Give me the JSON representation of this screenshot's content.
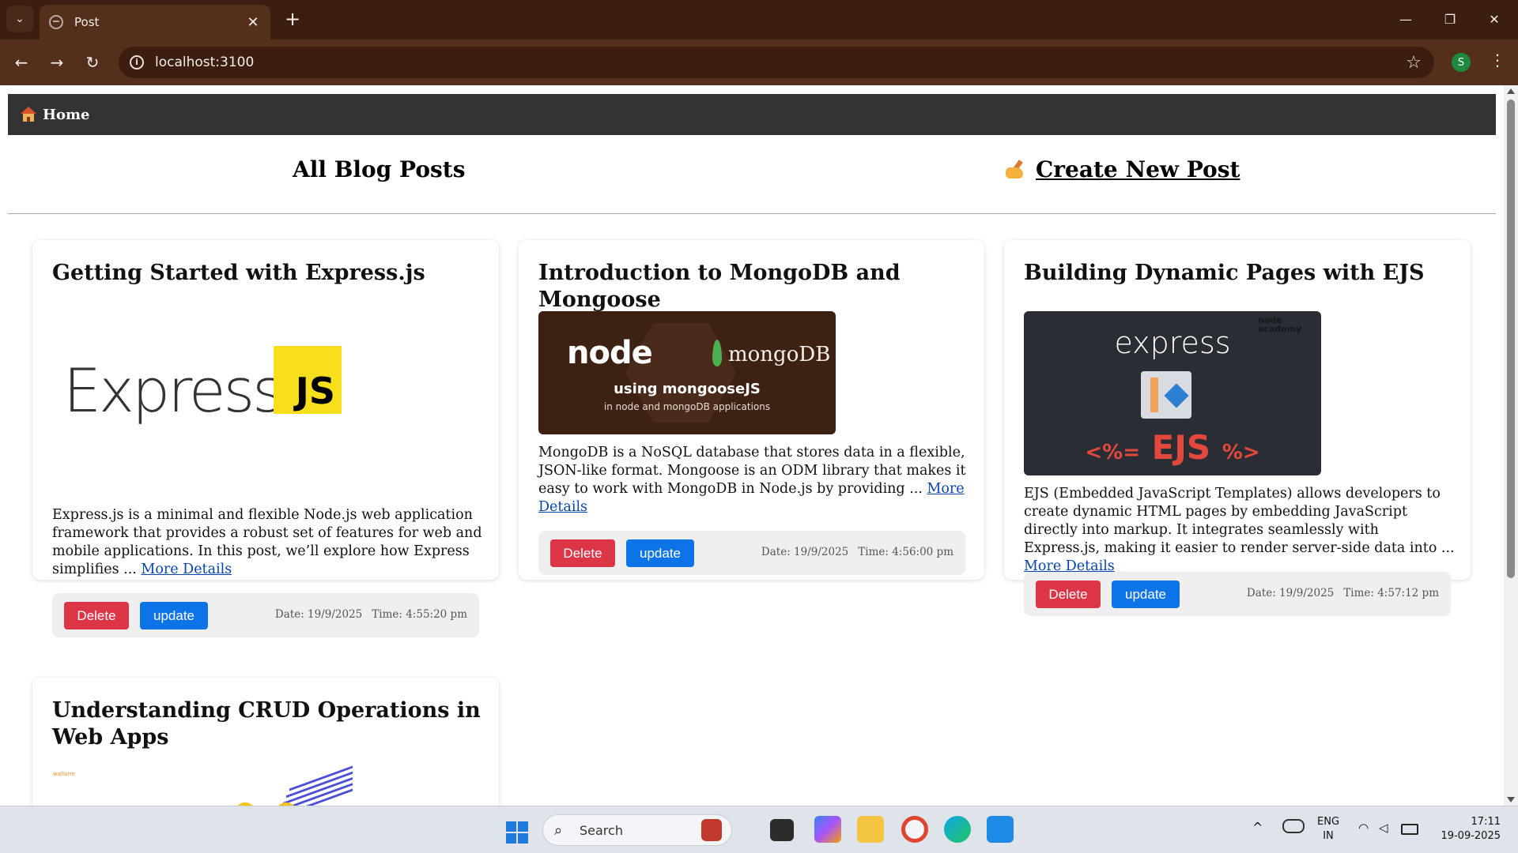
{
  "browser": {
    "tab_title": "Post",
    "tab_close": "✕",
    "new_tab": "+",
    "url": "localhost:3100",
    "profile_initial": "S",
    "back": "←",
    "forward": "→",
    "reload": "↻",
    "star": "☆",
    "menu": "⋮",
    "tab_search": "⌄",
    "minimize": "—",
    "maximize": "❐",
    "close": "✕"
  },
  "nav": {
    "home_label": "Home"
  },
  "header": {
    "title": "All Blog Posts",
    "create_label": "Create New Post"
  },
  "posts": [
    {
      "title": "Getting Started with Express.js",
      "image_logo_text": "Express",
      "image_badge_text": "JS",
      "excerpt": "Express.js is a minimal and flexible Node.js web application framework that provides a robust set of features for web and mobile applications. In this post, we’ll explore how Express simplifies ...",
      "more_label": "More Details",
      "delete_label": "Delete",
      "update_label": "update",
      "date": "Date: 19/9/2025",
      "time": "Time: 4:55:20 pm"
    },
    {
      "title": "Introduction to MongoDB and Mongoose",
      "image_node_text": "node",
      "image_mongo_text": "mongoDB",
      "image_using_text": "using mongooseJS",
      "image_sub_text": "in node and mongoDB applications",
      "excerpt": "MongoDB is a NoSQL database that stores data in a flexible, JSON-like format. Mongoose is an ODM library that makes it easy to work with MongoDB in Node.js by providing ...",
      "more_label": "More Details",
      "delete_label": "Delete",
      "update_label": "update",
      "date": "Date: 19/9/2025",
      "time": "Time: 4:56:00 pm"
    },
    {
      "title": "Building Dynamic Pages with EJS",
      "image_express_text": "express",
      "image_brand_text": "node academy",
      "image_ejs_left": "<%=",
      "image_ejs_mid": " EJS ",
      "image_ejs_right": "%>",
      "excerpt": "EJS (Embedded JavaScript Templates) allows developers to create dynamic HTML pages by embedding JavaScript directly into markup. It integrates seamlessly with Express.js, making it easier to render server-side data into ...",
      "more_label": "More Details",
      "delete_label": "Delete",
      "update_label": "update",
      "date": "Date: 19/9/2025",
      "time": "Time: 4:57:12 pm"
    },
    {
      "title": "Understanding CRUD Operations in Web Apps",
      "image_logo_text": "wallarm"
    }
  ],
  "taskbar": {
    "search_label": "Search",
    "lang": "ENG",
    "region": "IN",
    "time": "17:11",
    "date": "19-09-2025",
    "tray_chevron": "^"
  },
  "colors": {
    "delete": "#dc3545",
    "update": "#0d74e7",
    "navbar": "#333333",
    "browser_frame": "#54301c"
  }
}
